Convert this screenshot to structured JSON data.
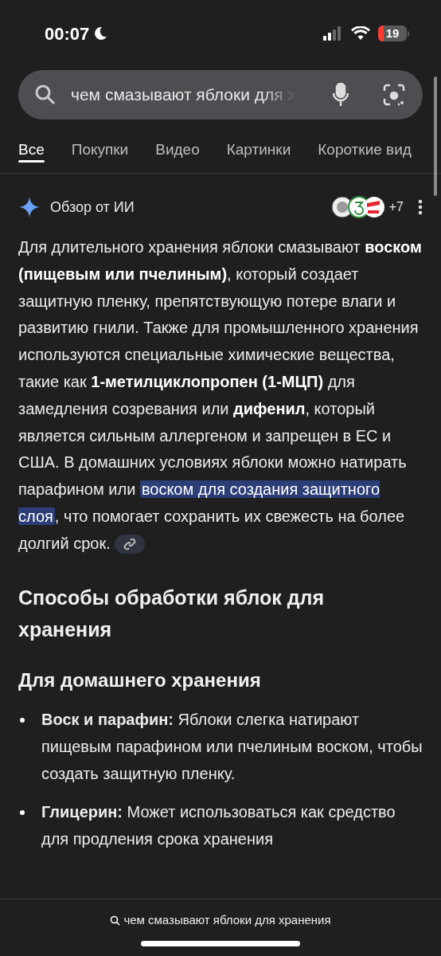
{
  "status_bar": {
    "time": "00:07",
    "focus_moon": true,
    "battery": "19",
    "battery_low": true
  },
  "search": {
    "query": "чем смазывают яблоки для х"
  },
  "tabs": [
    {
      "label": "Все",
      "selected": true
    },
    {
      "label": "Покупки",
      "selected": false
    },
    {
      "label": "Видео",
      "selected": false
    },
    {
      "label": "Картинки",
      "selected": false
    },
    {
      "label": "Короткие вид",
      "selected": false
    }
  ],
  "overview": {
    "title": "Обзор от ИИ",
    "sources_more": "+7",
    "paragraph": [
      {
        "kind": "plain",
        "text": "Для длительного хранения яблоки смазывают "
      },
      {
        "kind": "bold",
        "text": "воском (пищевым или пчелиным)"
      },
      {
        "kind": "plain",
        "text": ", который создает защитную пленку, препятствующую потере влаги и развитию гнили. Также для промышленного хранения используются специальные химические вещества, такие как "
      },
      {
        "kind": "bold",
        "text": "1-метилциклопропен (1-МЦП)"
      },
      {
        "kind": "plain",
        "text": " для замедления созревания или "
      },
      {
        "kind": "bold",
        "text": "дифенил"
      },
      {
        "kind": "plain",
        "text": ", который является сильным аллергеном и запрещен в ЕС и США. В домашних условиях яблоки можно натирать парафином или "
      },
      {
        "kind": "highlight",
        "text": "воском для создания защитного слоя"
      },
      {
        "kind": "plain",
        "text": ", что помогает сохранить их свежесть на более долгий срок."
      }
    ],
    "heading": "Способы обработки яблок для хранения",
    "subheading": "Для домашнего хранения",
    "bullets": [
      "**Воск и парафин:** Яблоки слегка натирают пищевым парафином или пчелиным воском, чтобы создать защитную пленку.",
      "**Глицерин:** Может использоваться как средство для продления срока хранения"
    ]
  },
  "bottom_bar": {
    "query": "чем смазывают яблоки для хранения"
  }
}
